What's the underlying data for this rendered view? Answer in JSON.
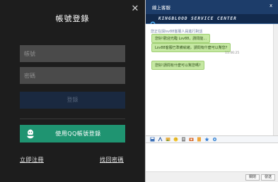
{
  "login": {
    "title": "帳號登錄",
    "account_placeholder": "帳號",
    "password_placeholder": "密碼",
    "login_label": "登錄",
    "qq_login_label": "使用QQ帳號登錄",
    "register_link": "立即注冊",
    "forgot_link": "找回密碼"
  },
  "chat": {
    "title": "線上客服",
    "close": "x",
    "banner_text": "KINGBLOOD SERVICE CENTER",
    "system_line": "您正在與lsv88客服人員進行對話",
    "messages": [
      {
        "text": "您好!歡迎光臨 Lsv88，請問能..."
      },
      {
        "text": "Lsv88客服已準備就緒，請問有什麼可以幫您?"
      },
      {
        "text": "您好!請問有什麼可以幫您嗎?"
      }
    ],
    "message_time": "11:46:25",
    "footer": {
      "close_label": "關閉",
      "send_label": "發送"
    }
  },
  "colors": {
    "login_bg": "#1d1d1d",
    "qq_green": "#1f9471",
    "login_btn": "#1a2940",
    "chat_header": "#1d3d6a",
    "bubble": "#c5e8a2"
  }
}
